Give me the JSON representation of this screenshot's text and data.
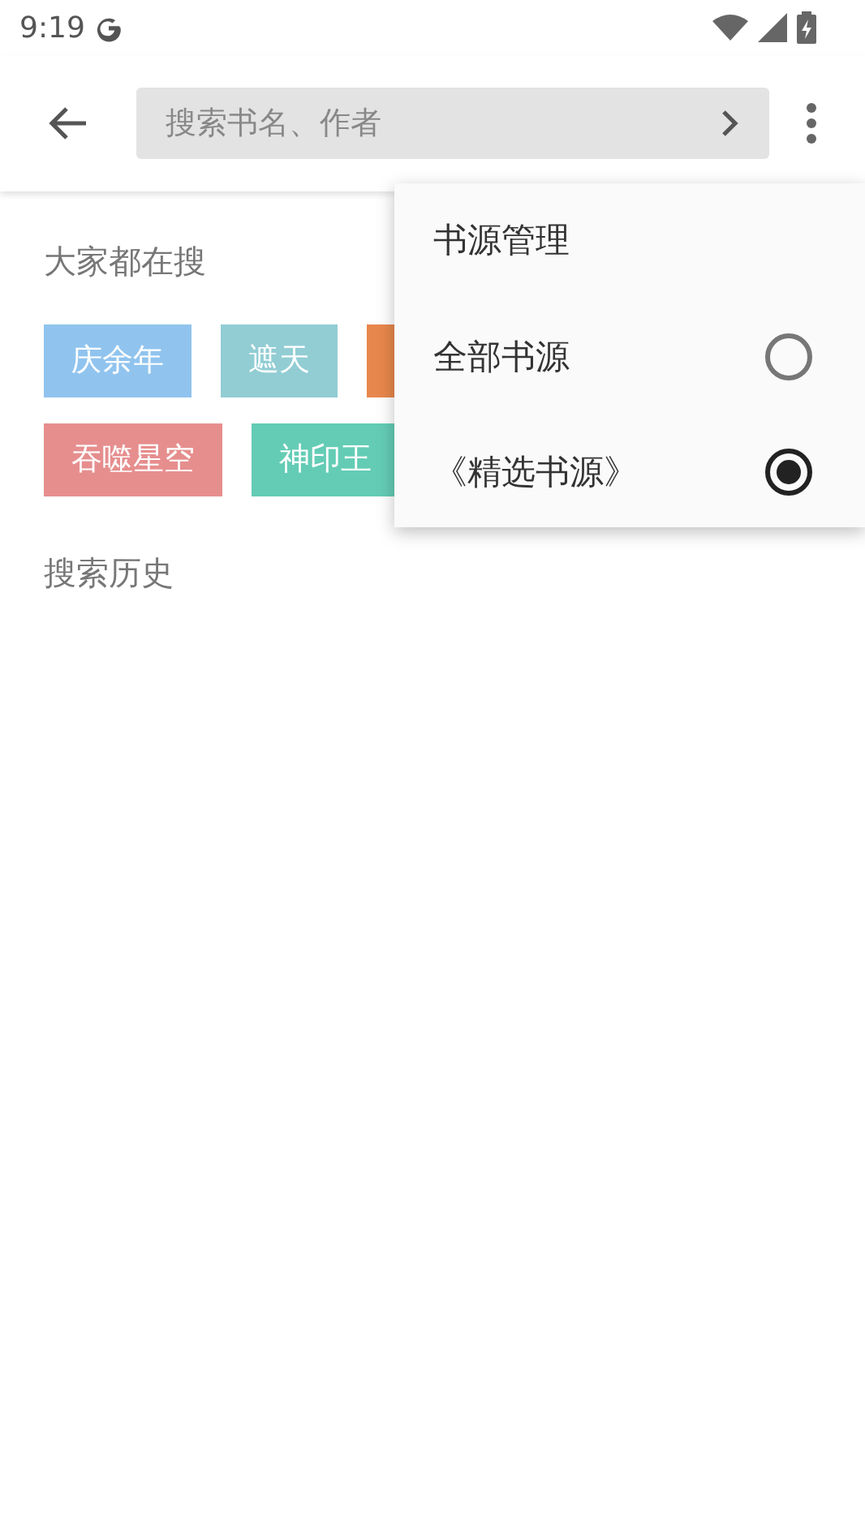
{
  "status_bar": {
    "time": "9:19"
  },
  "search": {
    "placeholder": "搜索书名、作者"
  },
  "hot": {
    "title": "大家都在搜",
    "tags": [
      {
        "label": "庆余年",
        "color": "#90c4ee"
      },
      {
        "label": "遮天",
        "color": "#92cdd4"
      },
      {
        "color": "#e8874c"
      },
      {
        "label": "吞噬星空",
        "color": "#e68e8e"
      },
      {
        "label": "神印王",
        "color": "#64ccb5"
      }
    ]
  },
  "history": {
    "title": "搜索历史"
  },
  "menu": {
    "title": "书源管理",
    "items": [
      {
        "label": "全部书源",
        "selected": false
      },
      {
        "label": "《精选书源》",
        "selected": true
      }
    ]
  }
}
